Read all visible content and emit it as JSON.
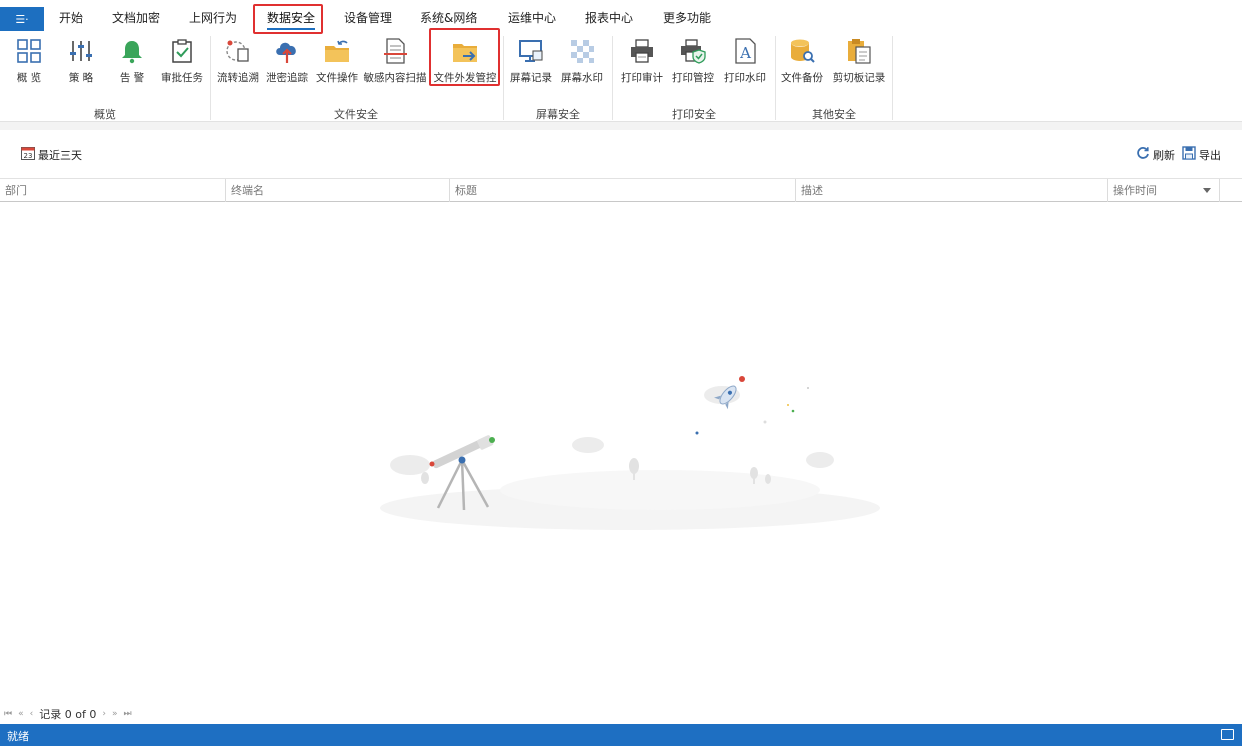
{
  "app_menu": {
    "label": "☰·"
  },
  "tabs": [
    {
      "label": "开始"
    },
    {
      "label": "文档加密"
    },
    {
      "label": "上网行为"
    },
    {
      "label": "数据安全"
    },
    {
      "label": "设备管理"
    },
    {
      "label": "系统&网络"
    },
    {
      "label": "运维中心"
    },
    {
      "label": "报表中心"
    },
    {
      "label": "更多功能"
    }
  ],
  "ribbon": {
    "groups": [
      {
        "label": "概览"
      },
      {
        "label": "文件安全"
      },
      {
        "label": "屏幕安全"
      },
      {
        "label": "打印安全"
      },
      {
        "label": "其他安全"
      }
    ],
    "buttons": [
      {
        "label": "概 览",
        "icon": "grid-icon"
      },
      {
        "label": "策 略",
        "icon": "sliders-icon"
      },
      {
        "label": "告 警",
        "icon": "bell-icon"
      },
      {
        "label": "审批任务",
        "icon": "clipboard-check-icon"
      },
      {
        "label": "流转追溯",
        "icon": "flow-trace-icon"
      },
      {
        "label": "泄密追踪",
        "icon": "cloud-upload-icon"
      },
      {
        "label": "文件操作",
        "icon": "folder-icon"
      },
      {
        "label": "敏感内容扫描",
        "icon": "document-scan-icon"
      },
      {
        "label": "文件外发管控",
        "icon": "folder-send-icon"
      },
      {
        "label": "屏幕记录",
        "icon": "monitor-icon"
      },
      {
        "label": "屏幕水印",
        "icon": "watermark-icon"
      },
      {
        "label": "打印审计",
        "icon": "printer-icon"
      },
      {
        "label": "打印管控",
        "icon": "printer-shield-icon"
      },
      {
        "label": "打印水印",
        "icon": "letter-a-icon"
      },
      {
        "label": "文件备份",
        "icon": "database-search-icon"
      },
      {
        "label": "剪切板记录",
        "icon": "clipboard-icon"
      }
    ]
  },
  "toolbar": {
    "date_range": "最近三天",
    "calendar_day": "23",
    "refresh": "刷新",
    "export": "导出"
  },
  "table": {
    "columns": [
      "部门",
      "终端名",
      "标题",
      "描述",
      "操作时间"
    ]
  },
  "pager": {
    "first": "⏮",
    "prev_page": "«",
    "prev": "‹",
    "record_text": "记录 0 of 0",
    "next": "›",
    "next_page": "»",
    "last": "⏭"
  },
  "status": {
    "text": "就绪"
  },
  "colors": {
    "accent": "#1d6fc0",
    "highlight": "#e03030",
    "status_bar": "#1e6fc2"
  }
}
